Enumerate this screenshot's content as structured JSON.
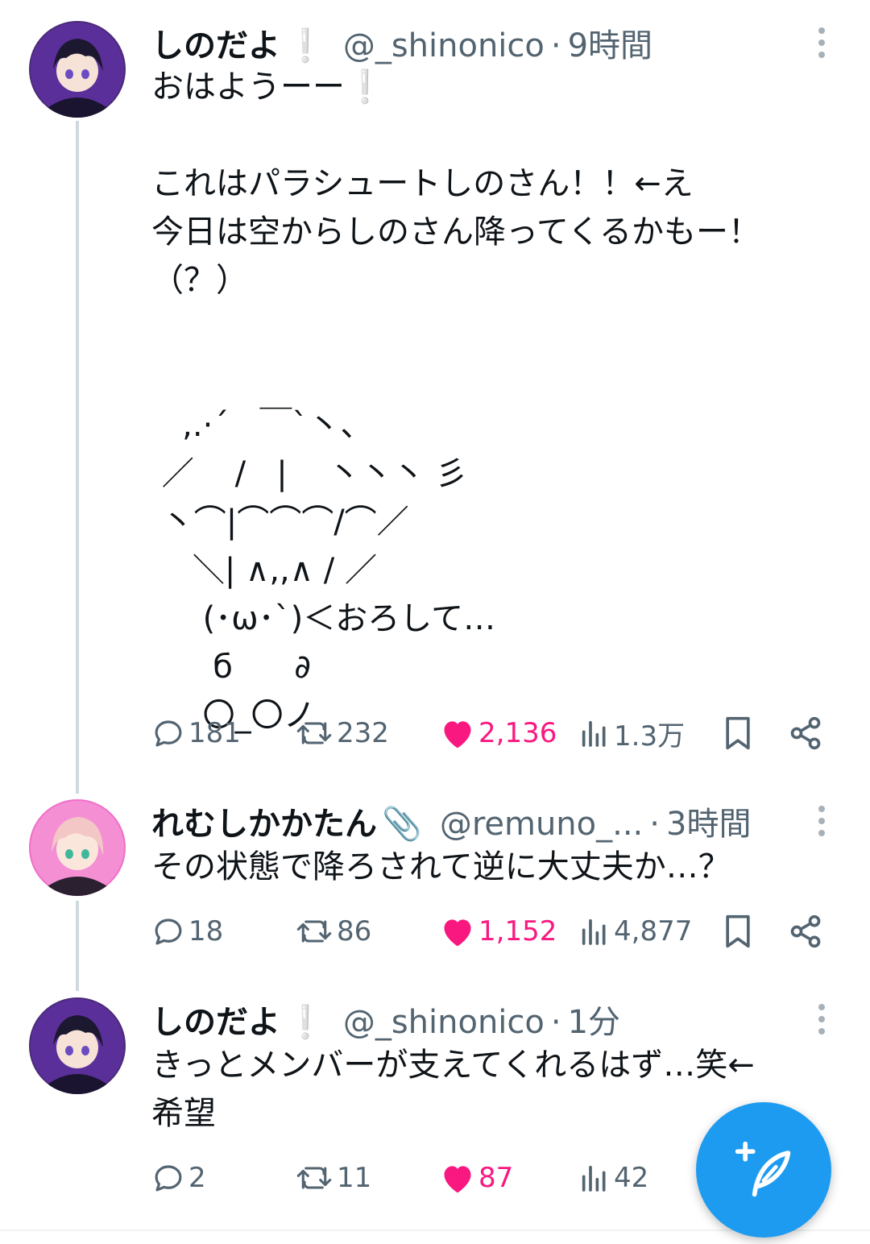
{
  "tweets": [
    {
      "display_name": "しのだよ",
      "badge": "❕",
      "handle": "@_shinonico",
      "separator": "·",
      "time": "9時間",
      "text": "おはようーー❕\n\nこれはパラシュートしのさん！！←え\n今日は空からしのさん降ってくるかもー！\n（？）\n\n\n   ,.·´   ￣`丶、\n ／    /   |    丶丶丶 彡\n 丶⌒|⌒⌒⌒/⌒／\n    ＼| ∧,,∧ / ／\n     (･ω･`)＜おろして…\n      б      ∂\n     〇_〇ノ",
      "replies": "181",
      "retweets": "232",
      "likes": "2,136",
      "views": "1.3万"
    },
    {
      "display_name": "れむしかかたん",
      "badge": "📎",
      "handle": "@remuno_...",
      "separator": "·",
      "time": "3時間",
      "text": "その状態で降ろされて逆に大丈夫か…？",
      "replies": "18",
      "retweets": "86",
      "likes": "1,152",
      "views": "4,877"
    },
    {
      "display_name": "しのだよ",
      "badge": "❕",
      "handle": "@_shinonico",
      "separator": "·",
      "time": "1分",
      "text": "きっとメンバーが支えてくれるはず…笑←\n希望",
      "replies": "2",
      "retweets": "11",
      "likes": "87",
      "views": "42"
    }
  ],
  "icons": {
    "reply": "reply-icon",
    "retweet": "retweet-icon",
    "like": "heart-icon",
    "views": "views-icon",
    "bookmark": "bookmark-icon",
    "share": "share-icon",
    "compose": "compose-icon"
  },
  "colors": {
    "accent": "#1d9bf0",
    "like": "#f91880",
    "secondary_text": "#536471"
  }
}
